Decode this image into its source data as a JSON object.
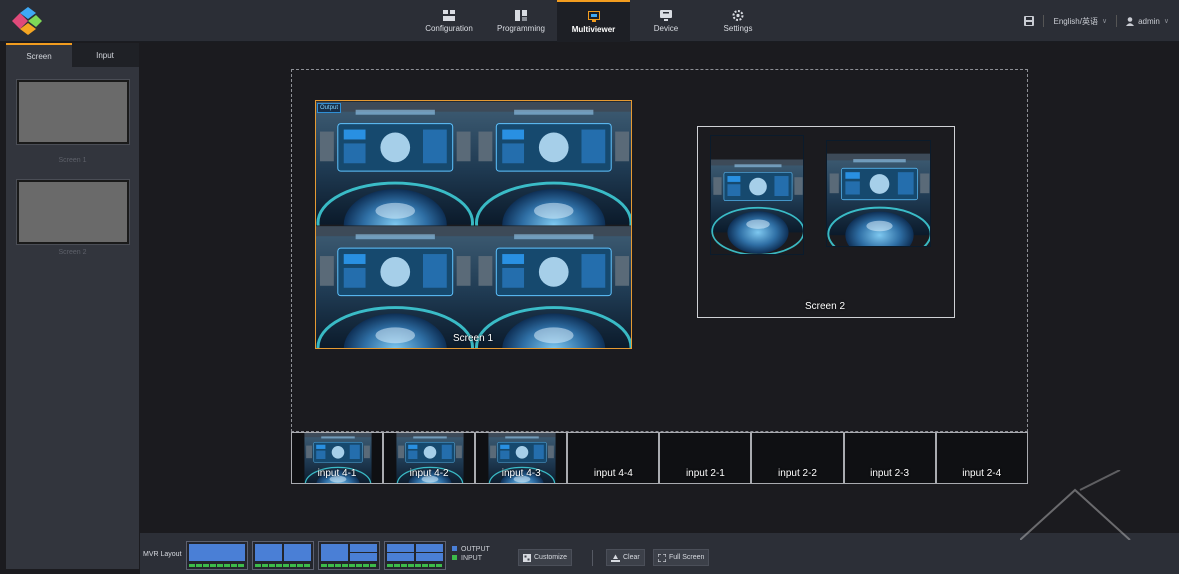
{
  "nav": {
    "items": [
      {
        "label": "Configuration",
        "icon": "configuration-icon"
      },
      {
        "label": "Programming",
        "icon": "programming-icon"
      },
      {
        "label": "Multiviewer",
        "icon": "multiviewer-icon"
      },
      {
        "label": "Device",
        "icon": "device-icon"
      },
      {
        "label": "Settings",
        "icon": "settings-icon"
      }
    ],
    "active": "Multiviewer"
  },
  "topRight": {
    "language": "English/英语",
    "user": "admin"
  },
  "sidebar": {
    "tabs": [
      "Screen",
      "Input"
    ],
    "activeTab": "Screen",
    "screens": [
      {
        "name": "Screen 1"
      },
      {
        "name": "Screen 2"
      }
    ]
  },
  "canvas": {
    "screen1": {
      "tag": "Output",
      "label": "Screen 1"
    },
    "screen2": {
      "label": "Screen 2"
    }
  },
  "inputs": [
    {
      "label": "input 4-1",
      "hasSignal": true
    },
    {
      "label": "input 4-2",
      "hasSignal": true
    },
    {
      "label": "input 4-3",
      "hasSignal": true
    },
    {
      "label": "input 4-4",
      "hasSignal": false
    },
    {
      "label": "input 2-1",
      "hasSignal": false
    },
    {
      "label": "input 2-2",
      "hasSignal": false
    },
    {
      "label": "input 2-3",
      "hasSignal": false
    },
    {
      "label": "input 2-4",
      "hasSignal": false
    }
  ],
  "toolbar": {
    "mvrLayoutLabel": "MVR Layout",
    "legendOutput": "OUTPUT",
    "legendInput": "INPUT",
    "customize": "Customize",
    "clear": "Clear",
    "fullScreen": "Full Screen"
  },
  "colors": {
    "accent": "#f29c1f",
    "outputLegend": "#4a7fd6",
    "inputLegend": "#3dbb4a"
  }
}
